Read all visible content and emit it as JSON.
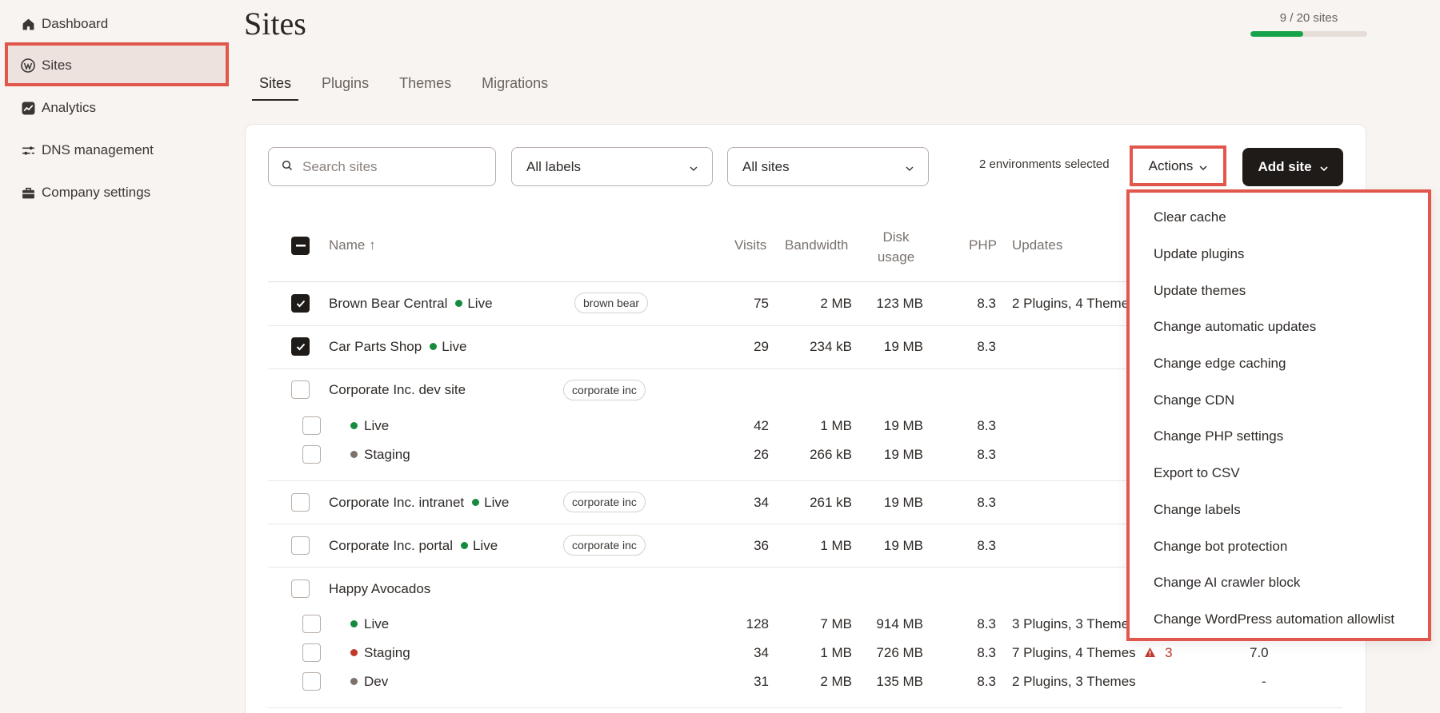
{
  "sidebar": {
    "items": [
      {
        "label": "Dashboard",
        "icon": "home-icon"
      },
      {
        "label": "Sites",
        "icon": "wordpress-icon"
      },
      {
        "label": "Analytics",
        "icon": "analytics-icon"
      },
      {
        "label": "DNS management",
        "icon": "dns-icon"
      },
      {
        "label": "Company settings",
        "icon": "briefcase-icon"
      }
    ],
    "active": "Sites"
  },
  "header": {
    "title": "Sites",
    "quota_text": "9 / 20 sites",
    "quota_fraction": 0.45,
    "quota_color": "#17a34a"
  },
  "tabs": [
    "Sites",
    "Plugins",
    "Themes",
    "Migrations"
  ],
  "toolbar": {
    "search_placeholder": "Search sites",
    "labels_filter": "All labels",
    "sites_filter": "All sites",
    "selection_text": "2 environments selected",
    "actions_label": "Actions",
    "add_site_label": "Add site"
  },
  "table": {
    "columns": {
      "name": "Name ↑",
      "visits": "Visits",
      "bandwidth": "Bandwidth",
      "disk_line1": "Disk",
      "disk_line2": "usage",
      "php": "PHP",
      "updates": "Updates"
    },
    "rows": [
      {
        "name": "Brown Bear Central",
        "status": "Live",
        "tag": "brown bear",
        "visits": "75",
        "bandwidth": "2 MB",
        "disk": "123 MB",
        "php": "8.3",
        "updates": "2 Plugins, 4 Themes",
        "checked": true
      },
      {
        "name": "Car Parts Shop",
        "status": "Live",
        "visits": "29",
        "bandwidth": "234 kB",
        "disk": "19 MB",
        "php": "8.3",
        "checked": true
      },
      {
        "name": "Corporate Inc. dev site",
        "tag": "corporate inc",
        "envs": [
          {
            "env": "Live",
            "visits": "42",
            "bandwidth": "1 MB",
            "disk": "19 MB",
            "php": "8.3"
          },
          {
            "env": "Staging",
            "visits": "26",
            "bandwidth": "266 kB",
            "disk": "19 MB",
            "php": "8.3"
          }
        ]
      },
      {
        "name": "Corporate Inc. intranet",
        "status": "Live",
        "tag": "corporate inc",
        "visits": "34",
        "bandwidth": "261 kB",
        "disk": "19 MB",
        "php": "8.3"
      },
      {
        "name": "Corporate Inc. portal",
        "status": "Live",
        "tag": "corporate inc",
        "visits": "36",
        "bandwidth": "1 MB",
        "disk": "19 MB",
        "php": "8.3"
      },
      {
        "name": "Happy Avocados",
        "envs": [
          {
            "env": "Live",
            "visits": "128",
            "bandwidth": "7 MB",
            "disk": "914 MB",
            "php": "8.3",
            "updates": "3 Plugins, 3 Themes"
          },
          {
            "env": "Staging",
            "visits": "34",
            "bandwidth": "1 MB",
            "disk": "726 MB",
            "php": "8.3",
            "updates": "7 Plugins, 4 Themes",
            "warning_count": "3",
            "last_col": "7.0"
          },
          {
            "env": "Dev",
            "visits": "31",
            "bandwidth": "2 MB",
            "disk": "135 MB",
            "php": "8.3",
            "updates": "2 Plugins, 3 Themes",
            "last_col": "-"
          }
        ]
      }
    ]
  },
  "status_colors": {
    "live": "#168a3e",
    "staging_gray": "#7d716c",
    "staging_red": "#c0392b",
    "dev": "#7d716c"
  },
  "actions_menu": [
    "Clear cache",
    "Update plugins",
    "Update themes",
    "Change automatic updates",
    "Change edge caching",
    "Change CDN",
    "Change PHP settings",
    "Export to CSV",
    "Change labels",
    "Change bot protection",
    "Change AI crawler block",
    "Change WordPress automation allowlist"
  ],
  "highlight_color": "#e2574c"
}
